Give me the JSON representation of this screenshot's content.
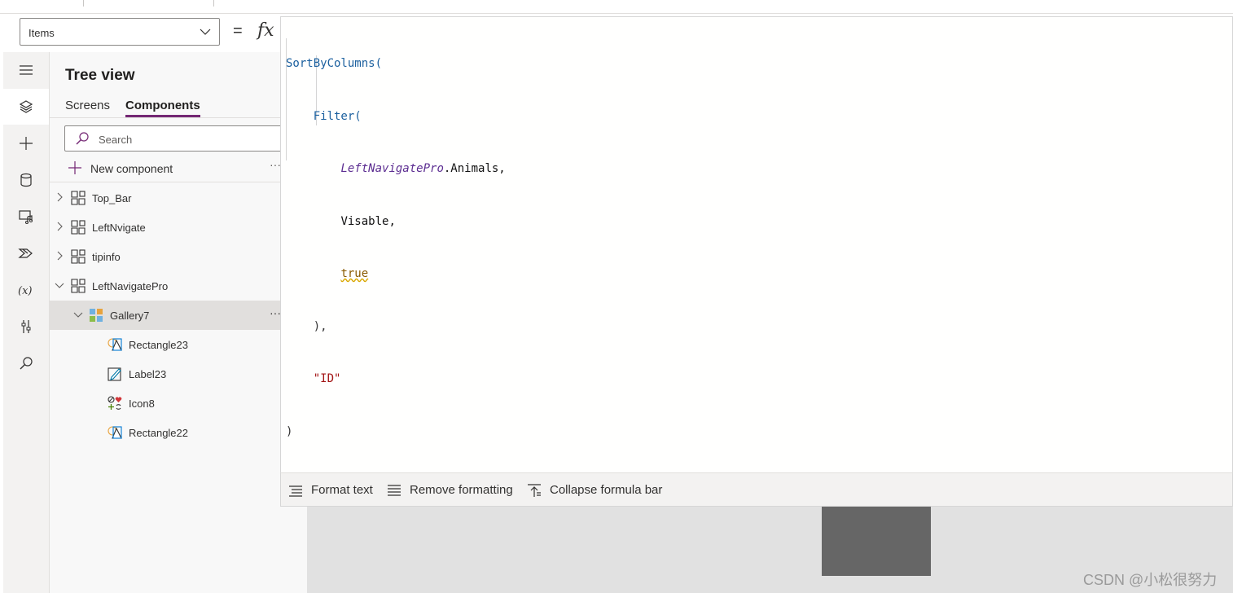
{
  "property_selector": {
    "value": "Items"
  },
  "formula_bar": {
    "equals": "=",
    "fx": "fx",
    "lines": [
      [
        "SortByColumns("
      ],
      [
        "Filter("
      ],
      [
        "LeftNavigatePro",
        ".Animals,"
      ],
      [
        "Visable,"
      ],
      [
        "true"
      ],
      [
        "),"
      ],
      [
        "\"ID\""
      ],
      [
        ")"
      ]
    ],
    "toolbar": {
      "format_text": "Format text",
      "remove_formatting": "Remove formatting",
      "collapse": "Collapse formula bar"
    }
  },
  "left_rail": {
    "items": [
      {
        "icon": "hamburger-menu-icon"
      },
      {
        "icon": "tree-view-layers-icon",
        "active": true
      },
      {
        "icon": "insert-plus-icon"
      },
      {
        "icon": "data-cylinder-icon"
      },
      {
        "icon": "media-icon"
      },
      {
        "icon": "power-automate-icon"
      },
      {
        "icon": "variables-icon"
      },
      {
        "icon": "advanced-tools-icon"
      },
      {
        "icon": "search-icon"
      }
    ]
  },
  "tree_view": {
    "title": "Tree view",
    "tabs": [
      "Screens",
      "Components"
    ],
    "selected_tab": "Components",
    "search_placeholder": "Search",
    "new_component": "New component",
    "more": "···",
    "items": [
      {
        "label": "Top_Bar",
        "expandable": true,
        "expanded": false,
        "icon": "component-icon"
      },
      {
        "label": "LeftNvigate",
        "expandable": true,
        "expanded": false,
        "icon": "component-icon"
      },
      {
        "label": "tipinfo",
        "expandable": true,
        "expanded": false,
        "icon": "component-icon"
      },
      {
        "label": "LeftNavigatePro",
        "expandable": true,
        "expanded": true,
        "icon": "component-icon"
      },
      {
        "label": "Gallery7",
        "expandable": true,
        "expanded": true,
        "selected": true,
        "icon": "gallery-icon"
      },
      {
        "label": "Rectangle23",
        "icon": "shape-icon"
      },
      {
        "label": "Label23",
        "icon": "label-edit-icon"
      },
      {
        "label": "Icon8",
        "icon": "icons-icon"
      },
      {
        "label": "Rectangle22",
        "icon": "shape-icon"
      }
    ]
  },
  "watermark": "CSDN @小松很努力",
  "colors": {
    "accent": "#742774",
    "selected_row": "#e1dfdd",
    "canvas_bg": "#e1e1e1",
    "canvas_block": "#666666"
  }
}
